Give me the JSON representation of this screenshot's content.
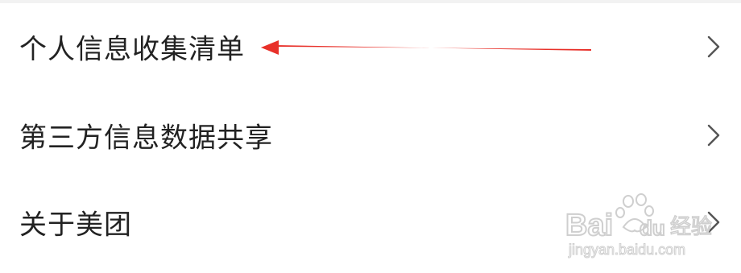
{
  "menu": {
    "items": [
      {
        "label": "个人信息收集清单"
      },
      {
        "label": "第三方信息数据共享"
      },
      {
        "label": "关于美团"
      }
    ]
  },
  "icons": {
    "item_chevron": "chevron-right-icon",
    "annotation": "red-arrow-icon"
  },
  "colors": {
    "text": "#222222",
    "chevron": "#555555",
    "annotation_arrow": "#e8312a",
    "watermark": "#c8c8c8"
  },
  "watermark": {
    "text": "Bai du 经验",
    "subtext": "jingyan.baidu.com"
  }
}
